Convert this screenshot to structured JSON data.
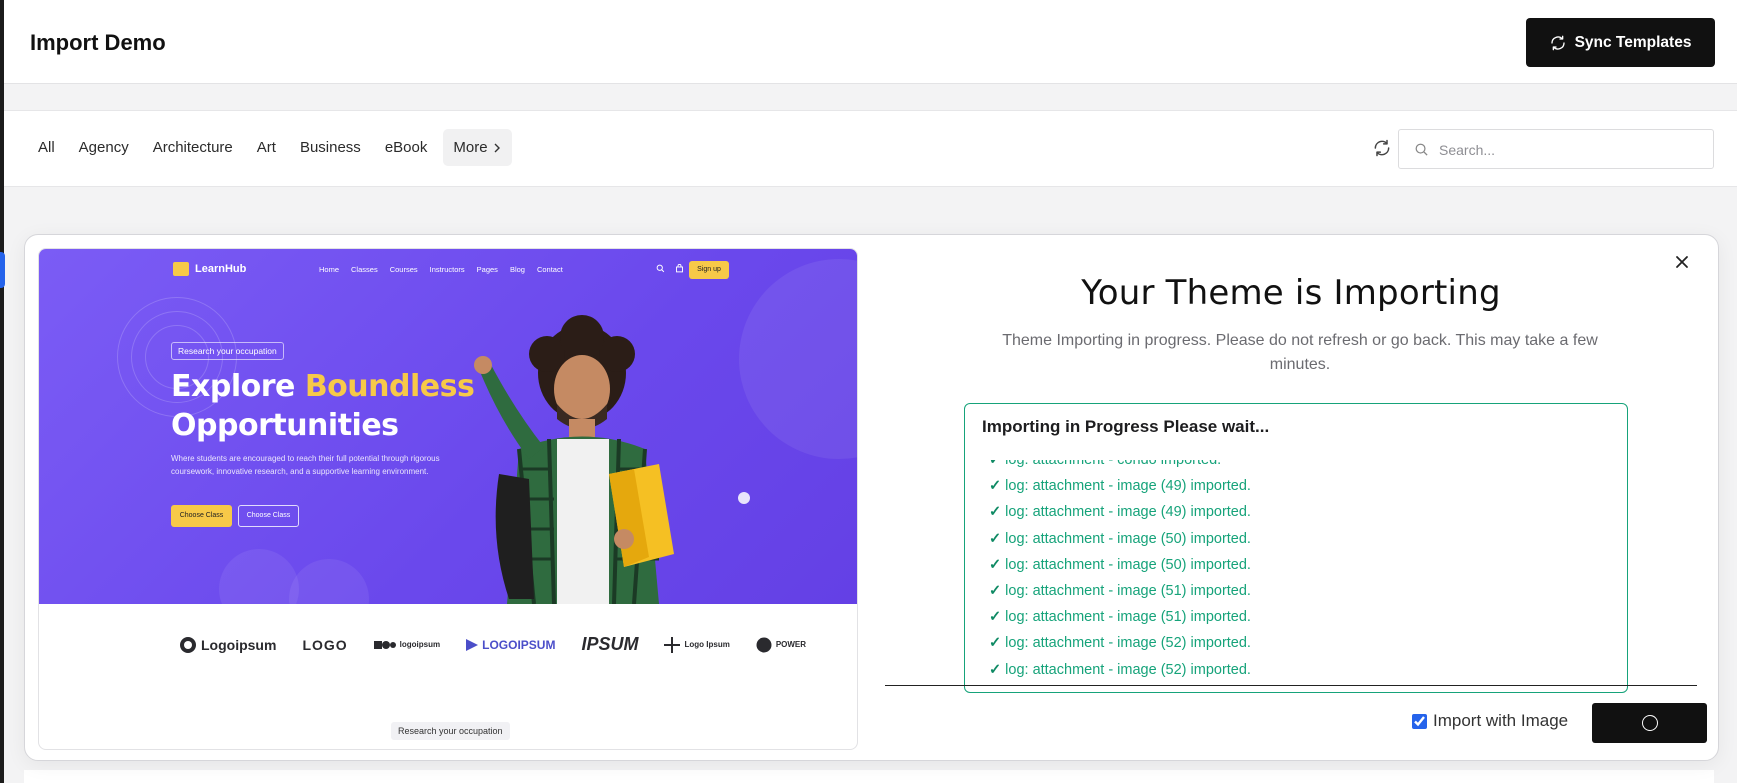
{
  "header": {
    "title": "Import Demo",
    "sync_label": "Sync Templates"
  },
  "filters": {
    "tabs": [
      "All",
      "Agency",
      "Architecture",
      "Art",
      "Business",
      "eBook"
    ],
    "more_label": "More",
    "search_placeholder": "Search..."
  },
  "preview": {
    "site": {
      "brand": "LearnHub",
      "nav": [
        "Home",
        "Classes",
        "Courses",
        "Instructors",
        "Pages",
        "Blog",
        "Contact"
      ],
      "signup": "Sign up",
      "pill": "Research your occupation",
      "headline_1": "Explore",
      "headline_highlight": "Boundless",
      "headline_2": "Opportunities",
      "subtext": "Where students are encouraged to reach their full potential through rigorous coursework, innovative research, and a supportive learning environment.",
      "btn_primary": "Choose Class",
      "btn_secondary": "Choose Class",
      "logos": [
        "Logoipsum",
        "LOGO",
        "logoipsum",
        "LOGOIPSUM",
        "IPSUM",
        "Logo Ipsum",
        "POWER"
      ],
      "footer_tag": "Research your occupation"
    }
  },
  "modal": {
    "title": "Your Theme is Importing",
    "subtitle": "Theme Importing in progress. Please do not refresh or go back. This may take a few minutes.",
    "log_title": "Importing in Progress Please wait...",
    "log_check": "✓",
    "log_lines": [
      "log: attachment - condo imported.",
      "log: attachment - image (49) imported.",
      "log: attachment - image (49) imported.",
      "log: attachment - image (50) imported.",
      "log: attachment - image (50) imported.",
      "log: attachment - image (51) imported.",
      "log: attachment - image (51) imported.",
      "log: attachment - image (52) imported.",
      "log: attachment - image (52) imported."
    ],
    "import_with_image_label": "Import with Image",
    "import_with_image_checked": true
  },
  "colors": {
    "accent_green": "#16a37a",
    "hero_purple": "#6a48ec",
    "highlight_yellow": "#f7c948"
  }
}
